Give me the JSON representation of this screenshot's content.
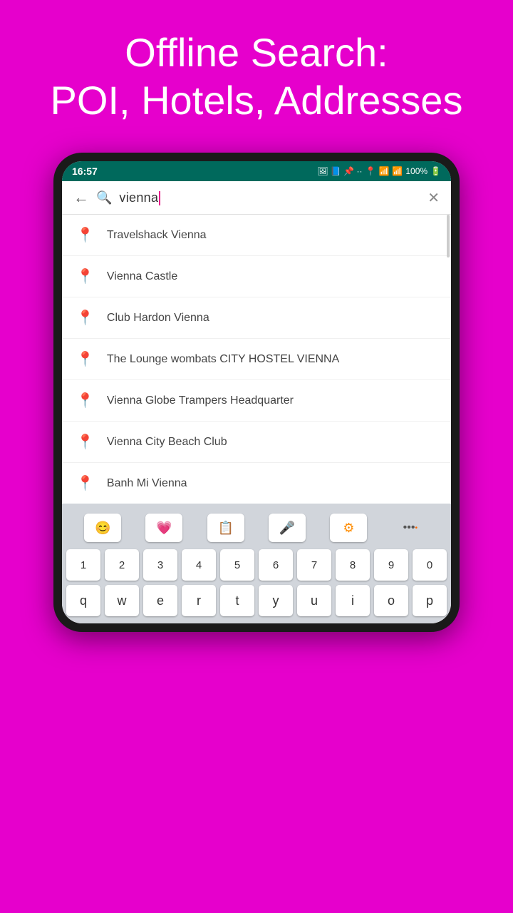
{
  "header": {
    "title": "Offline Search:",
    "subtitle": "POI, Hotels, Addresses"
  },
  "statusBar": {
    "time": "16:57",
    "battery": "100%"
  },
  "searchBar": {
    "query": "vienna",
    "back_label": "←",
    "clear_label": "✕"
  },
  "results": [
    {
      "id": 1,
      "text": "Travelshack Vienna"
    },
    {
      "id": 2,
      "text": "Vienna Castle"
    },
    {
      "id": 3,
      "text": "Club Hardon Vienna"
    },
    {
      "id": 4,
      "text": "The Lounge wombats CITY HOSTEL VIENNA"
    },
    {
      "id": 5,
      "text": "Vienna Globe Trampers Headquarter"
    },
    {
      "id": 6,
      "text": "Vienna City Beach Club"
    },
    {
      "id": 7,
      "text": "Banh Mi Vienna"
    }
  ],
  "keyboard": {
    "toolbar": [
      "😊",
      "💗",
      "📋",
      "🎤",
      "⚙",
      "•••"
    ],
    "row1": [
      "1",
      "2",
      "3",
      "4",
      "5",
      "6",
      "7",
      "8",
      "9",
      "0"
    ],
    "row2": [
      "q",
      "w",
      "e",
      "r",
      "t",
      "y",
      "u",
      "i",
      "o",
      "p"
    ]
  }
}
